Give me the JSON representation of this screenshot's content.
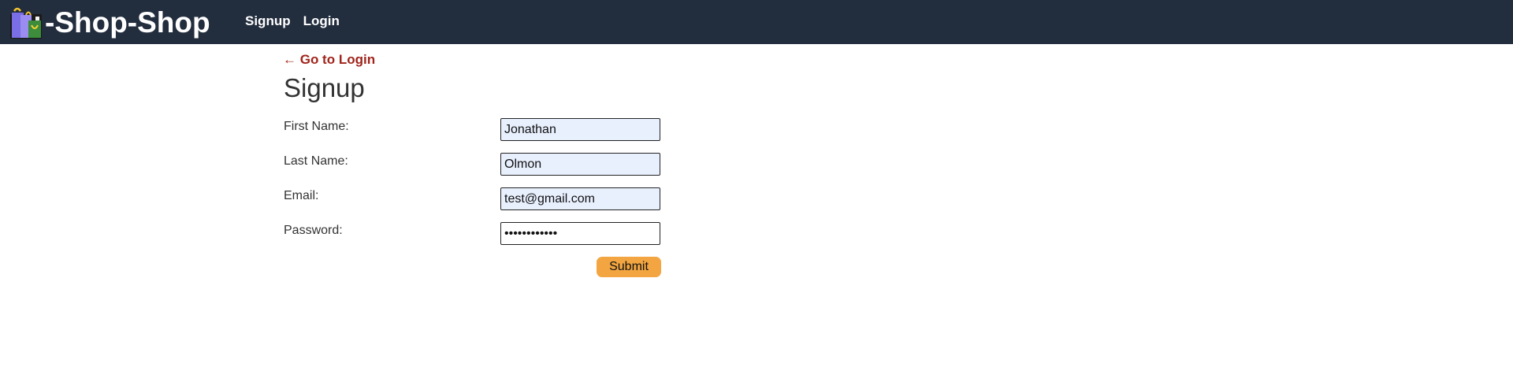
{
  "navbar": {
    "brand_text": "-Shop-Shop",
    "logo_icon": "shopping-bags-icon",
    "links": [
      {
        "label": "Signup"
      },
      {
        "label": "Login"
      }
    ]
  },
  "back_link": "← Go to Login",
  "page_title": "Signup",
  "form": {
    "first_name": {
      "label": "First Name:",
      "value": "Jonathan"
    },
    "last_name": {
      "label": "Last Name:",
      "value": "Olmon"
    },
    "email": {
      "label": "Email:",
      "value": "test@gmail.com"
    },
    "password": {
      "label": "Password:",
      "value": "••••••••••••"
    },
    "submit_label": "Submit"
  },
  "colors": {
    "navbar_bg": "#222d3e",
    "back_link": "#a0241b",
    "submit_button": "#f2a541",
    "autofill_input_bg": "#e8f0fe"
  }
}
